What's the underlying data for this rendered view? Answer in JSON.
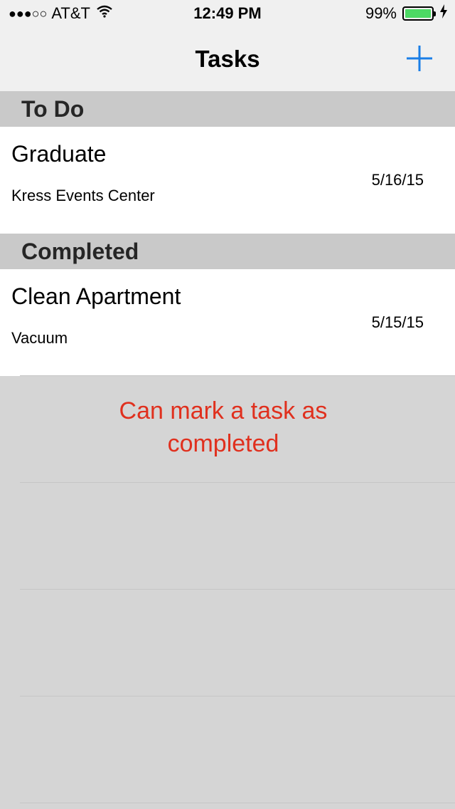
{
  "status_bar": {
    "signal": "●●●○○",
    "carrier": "AT&T",
    "time": "12:49 PM",
    "battery_percent": "99%",
    "battery_level": 0.99,
    "battery_color": "#4cd964"
  },
  "nav": {
    "title": "Tasks",
    "add_icon": "plus-icon",
    "accent": "#1a7ee6"
  },
  "sections": [
    {
      "header": "To Do",
      "rows": [
        {
          "title": "Graduate",
          "subtitle": "Kress Events Center",
          "date": "5/16/15"
        }
      ]
    },
    {
      "header": "Completed",
      "rows": [
        {
          "title": "Clean Apartment",
          "subtitle": "Vacuum",
          "date": "5/15/15"
        }
      ]
    }
  ],
  "annotation": {
    "line1": "Can mark a task as",
    "line2": "completed",
    "color": "#e0301e"
  }
}
